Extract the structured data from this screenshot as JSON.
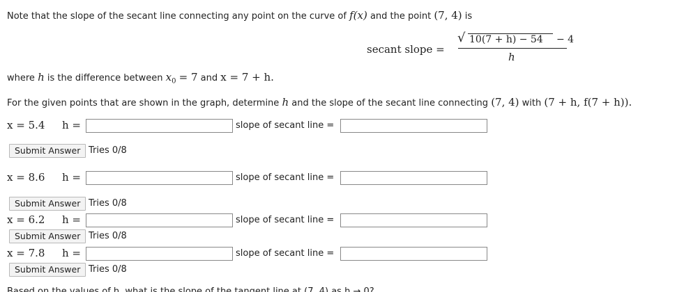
{
  "intro": {
    "text_before": "Note that the slope of the secant line connecting any point on the curve of",
    "function": "f(x)",
    "text_middle": "and the point",
    "point": "(7, 4)",
    "text_after": "is"
  },
  "formula": {
    "label": "secant slope =",
    "numerator": "10(7 + h) − 54 − 4",
    "sqrt_content": "10(7 + h) − 54",
    "minus_four": "− 4",
    "denominator": "h"
  },
  "where": {
    "prefix": "where",
    "h": "h",
    "middle": "is the difference between",
    "x0": "x",
    "x0_sub": "0",
    "x0_eq": "= 7",
    "and": "and",
    "x_eq": "x = 7 + h."
  },
  "instruction": {
    "text_before": "For the given points that are shown in the graph, determine",
    "h": "h",
    "text_middle": "and the slope of the secant line connecting",
    "point": "(7, 4)",
    "with": "with",
    "second_point": "(7 + h, f(7 + h))."
  },
  "rows": [
    {
      "x_label": "x = 5.4",
      "h_label": "h =",
      "h_value": "",
      "slope_label": "slope of secant line =",
      "slope_value": "",
      "submit_label": "Submit Answer",
      "tries": "Tries 0/8"
    },
    {
      "x_label": "x = 8.6",
      "h_label": "h =",
      "h_value": "",
      "slope_label": "slope of secant line =",
      "slope_value": "",
      "submit_label": "Submit Answer",
      "tries": "Tries 0/8"
    },
    {
      "x_label": "x = 6.2",
      "h_label": "h =",
      "h_value": "",
      "slope_label": "slope of secant line =",
      "slope_value": "",
      "submit_label": "Submit Answer",
      "tries": "Tries 0/8"
    },
    {
      "x_label": "x = 7.8",
      "h_label": "h =",
      "h_value": "",
      "slope_label": "slope of secant line =",
      "slope_value": "",
      "submit_label": "Submit Answer",
      "tries": "Tries 0/8"
    }
  ],
  "footer_partial": {
    "text": "Based on the values of h, what is the slope of the tangent line at (7, 4) as h → 0?"
  }
}
